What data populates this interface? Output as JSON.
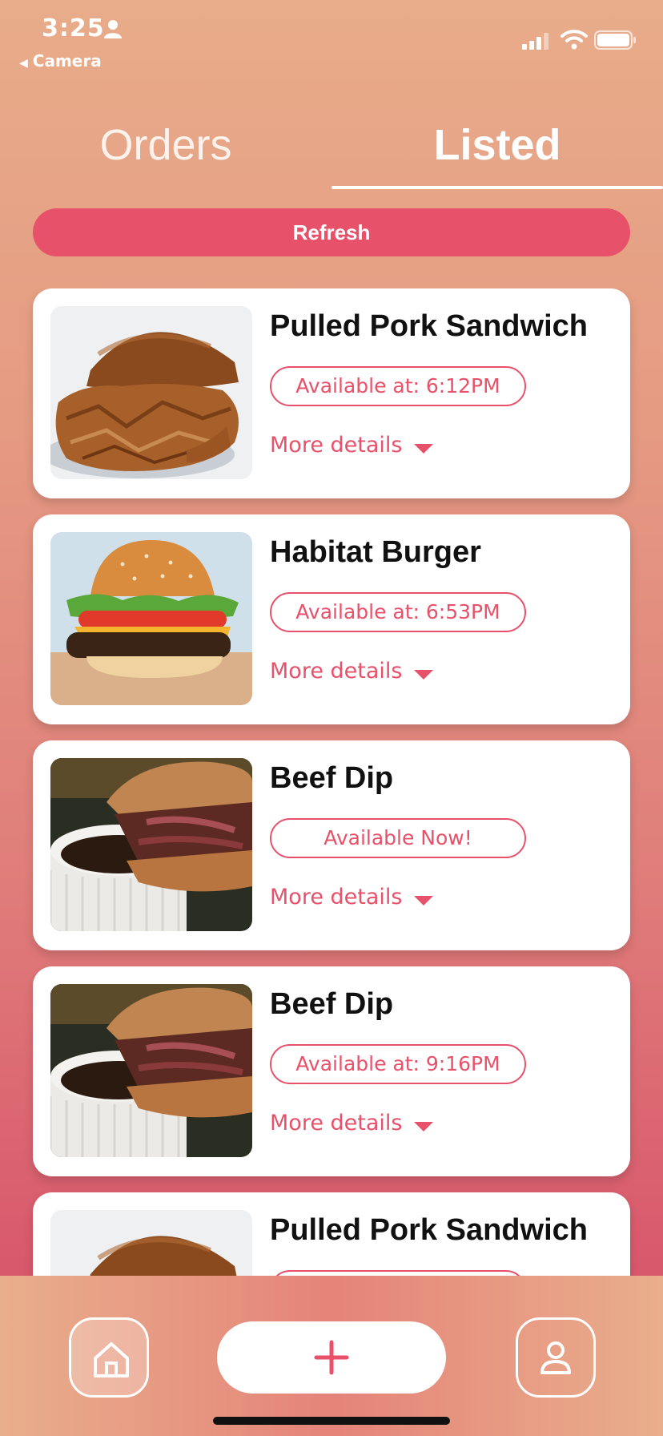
{
  "status_bar": {
    "time": "3:25",
    "back_label": "Camera"
  },
  "tabs": [
    {
      "label": "Orders",
      "active": false
    },
    {
      "label": "Listed",
      "active": true
    }
  ],
  "refresh_label": "Refresh",
  "items": [
    {
      "title": "Pulled Pork Sandwich",
      "availability": "Available  at: 6:12PM",
      "details_label": "More details",
      "image": "pulled-pork-sandwich-photo"
    },
    {
      "title": "Habitat Burger",
      "availability": "Available  at: 6:53PM",
      "details_label": "More details",
      "image": "burger-photo"
    },
    {
      "title": "Beef Dip",
      "availability": "Available  Now!",
      "details_label": "More details",
      "image": "beef-dip-photo"
    },
    {
      "title": "Beef Dip",
      "availability": "Available  at: 9:16PM",
      "details_label": "More details",
      "image": "beef-dip-photo"
    },
    {
      "title": "Pulled Pork Sandwich",
      "availability": "",
      "details_label": "",
      "image": "pulled-pork-sandwich-photo"
    }
  ],
  "bottom_nav": {
    "home_icon": "home-icon",
    "add_icon": "plus-icon",
    "profile_icon": "user-icon"
  },
  "colors": {
    "accent": "#e8516a",
    "background_top": "#e8ac8a",
    "background_bottom": "#d6506a"
  }
}
